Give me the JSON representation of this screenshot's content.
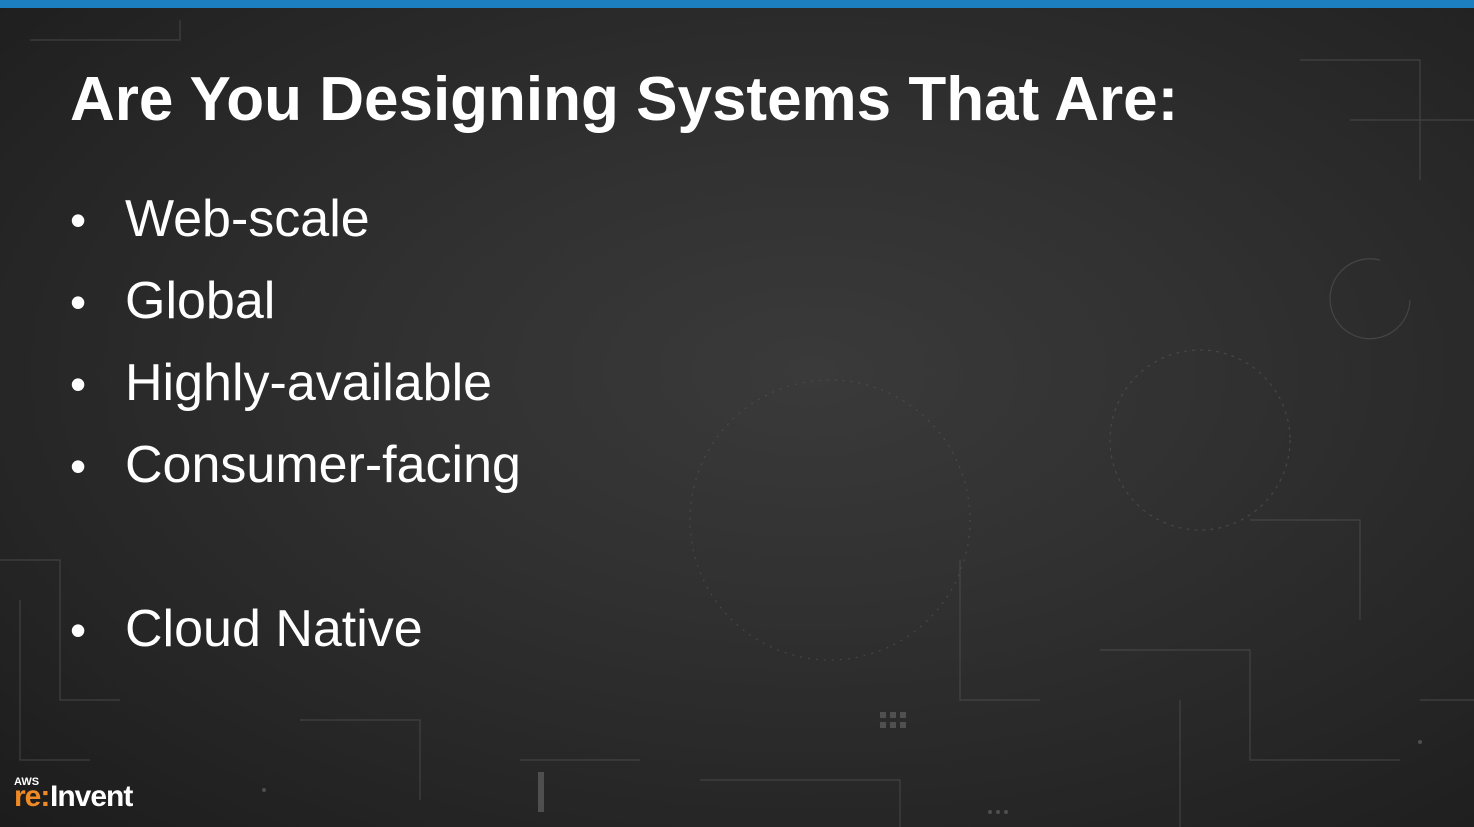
{
  "slide": {
    "title": "Are You Designing Systems That Are:",
    "bullet_symbol": "•",
    "bullets": [
      "Web-scale",
      "Global",
      "Highly-available",
      "Consumer-facing",
      "Cloud Native"
    ]
  },
  "logo": {
    "aws": "AWS",
    "re": "re:",
    "invent": "Invent"
  },
  "colors": {
    "top_bar": "#1b7fc0",
    "background": "#2b2b2b",
    "text": "#ffffff",
    "logo_accent": "#f08a24"
  }
}
